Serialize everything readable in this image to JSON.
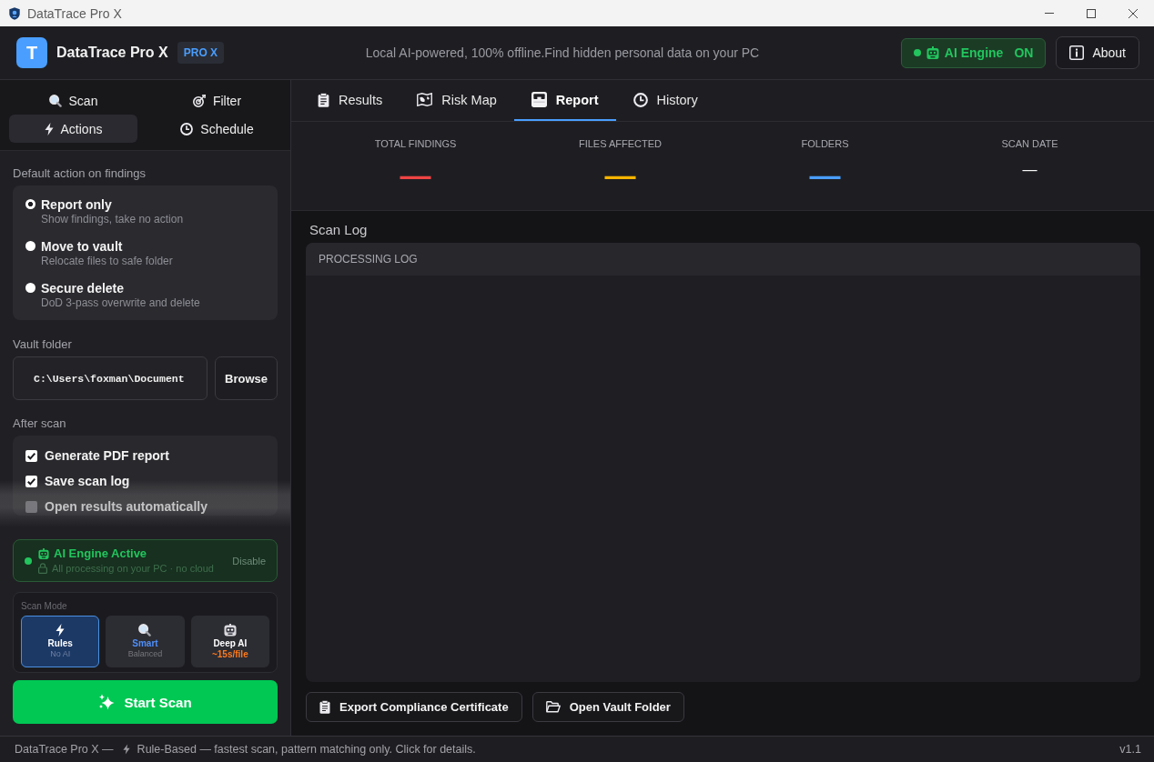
{
  "window": {
    "title": "DataTrace Pro X"
  },
  "header": {
    "logo_letter": "T",
    "app_name": "DataTrace Pro X",
    "badge": "PRO X",
    "tagline": "Local AI-powered, 100% offline.Find hidden personal data on your PC",
    "engine_status": {
      "label": "AI Engine",
      "state": "ON",
      "on": true
    },
    "about_button": "About"
  },
  "sidebar": {
    "tabs": [
      {
        "label": "Scan",
        "selected": false
      },
      {
        "label": "Filter",
        "selected": false
      },
      {
        "label": "Actions",
        "selected": true
      },
      {
        "label": "Schedule",
        "selected": false
      }
    ],
    "default_action": {
      "title": "Default action on findings",
      "options": [
        {
          "label": "Report only",
          "description": "Show findings, take no action",
          "selected": true
        },
        {
          "label": "Move to vault",
          "description": "Relocate files to safe folder",
          "selected": false
        },
        {
          "label": "Secure delete",
          "description": "DoD 3-pass overwrite and delete",
          "selected": false
        }
      ]
    },
    "vault_folder": {
      "label": "Vault folder",
      "value": "C:\\Users\\foxman\\Document",
      "browse_button": "Browse"
    },
    "after_scan": {
      "title": "After scan",
      "options": [
        {
          "label": "Generate PDF report",
          "checked": true
        },
        {
          "label": "Save scan log",
          "checked": true
        },
        {
          "label": "Open results automatically",
          "checked": false
        }
      ]
    },
    "ai_engine": {
      "title": "AI Engine Active",
      "subtitle": "All processing on your PC · no cloud",
      "action": "Disable"
    },
    "scan_mode": {
      "title": "Scan Mode",
      "modes": [
        {
          "label": {
            "text": "Rules"
          },
          "detail": {
            "text": "No AI"
          },
          "selected": true
        },
        {
          "label": {
            "text": "Smart",
            "color": "#4f8ff7"
          },
          "detail": {
            "text": "Balanced"
          },
          "selected": false
        },
        {
          "label": {
            "text": "Deep AI"
          },
          "detail": {
            "text": "~15s/file",
            "color": "#ff7a1a"
          },
          "selected": false
        }
      ]
    },
    "start_button": "Start Scan"
  },
  "main": {
    "tabs": [
      {
        "label": "Results",
        "selected": false
      },
      {
        "label": "Risk Map",
        "selected": false
      },
      {
        "label": "Report",
        "selected": true
      },
      {
        "label": "History",
        "selected": false
      }
    ],
    "stats": [
      {
        "label": "TOTAL FINDINGS",
        "value": "—",
        "kind": "count",
        "color": "#ef4444"
      },
      {
        "label": "FILES AFFECTED",
        "value": "—",
        "kind": "count",
        "color": "#f5b400"
      },
      {
        "label": "FOLDERS",
        "value": "—",
        "kind": "count",
        "color": "#4a9eff"
      },
      {
        "label": "SCAN DATE",
        "value": "—",
        "kind": "date",
        "color": "#ffffff"
      }
    ],
    "scan_log": {
      "title": "Scan Log",
      "header": "PROCESSING LOG"
    },
    "actions": [
      "Export Compliance Certificate",
      "Open Vault Folder"
    ]
  },
  "status_bar": {
    "prefix": "DataTrace Pro X —",
    "message": "Rule-Based — fastest scan, pattern matching only. Click for details.",
    "version": "v1.1"
  }
}
